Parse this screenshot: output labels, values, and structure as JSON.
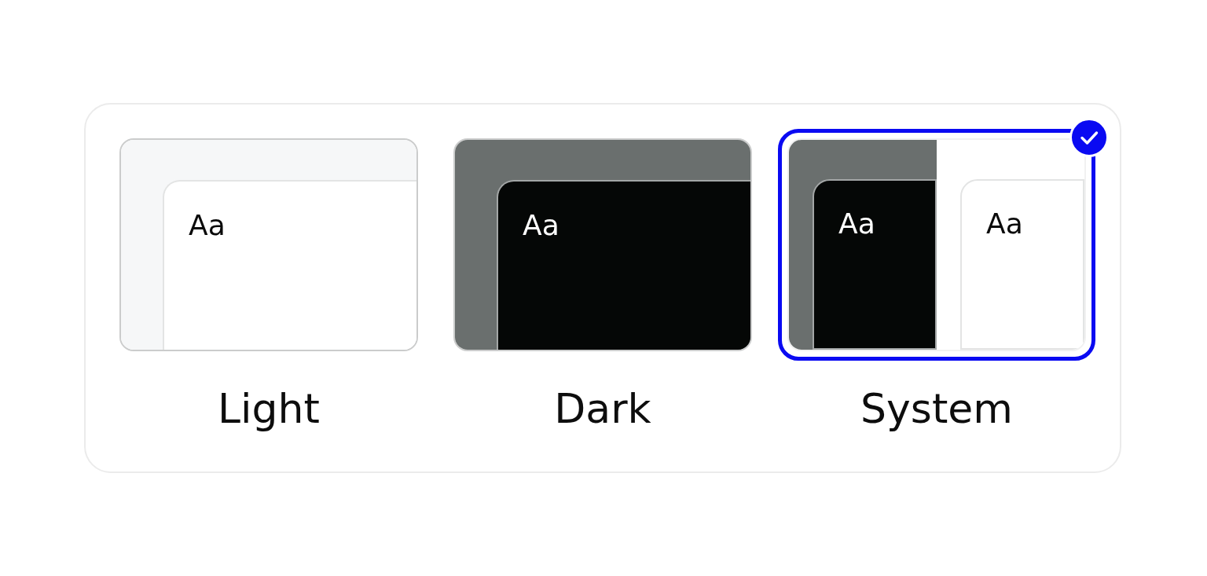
{
  "theme_options": [
    {
      "label": "Light",
      "selected": false,
      "panes": [
        {
          "kind": "light",
          "sample": "Aa"
        }
      ]
    },
    {
      "label": "Dark",
      "selected": false,
      "panes": [
        {
          "kind": "dark",
          "sample": "Aa"
        }
      ]
    },
    {
      "label": "System",
      "selected": true,
      "panes": [
        {
          "kind": "dark",
          "sample": "Aa"
        },
        {
          "kind": "light",
          "sample": "Aa"
        }
      ]
    }
  ]
}
